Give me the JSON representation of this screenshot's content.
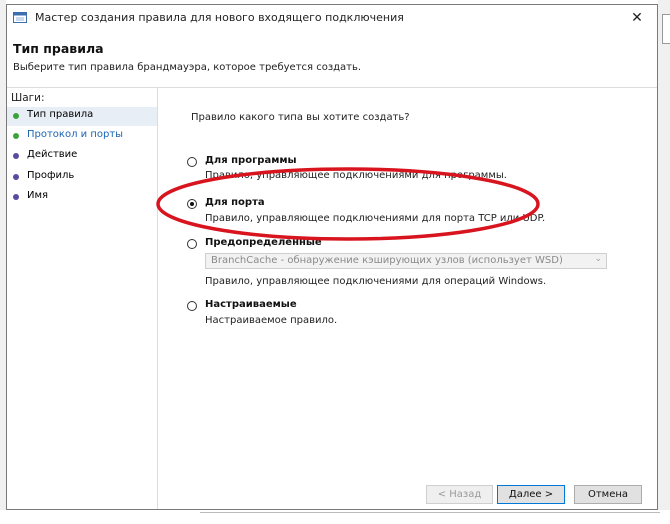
{
  "window": {
    "title": "Мастер создания правила для нового входящего подключения",
    "close_glyph": "✕"
  },
  "header": {
    "title": "Тип правила",
    "subtitle": "Выберите тип правила брандмауэра, которое требуется создать."
  },
  "steps": {
    "title": "Шаги:",
    "items": [
      {
        "label": "Тип правила",
        "status": "completed"
      },
      {
        "label": "Протокол и порты",
        "status": "current"
      },
      {
        "label": "Действие",
        "status": "pending"
      },
      {
        "label": "Профиль",
        "status": "pending"
      },
      {
        "label": "Имя",
        "status": "pending"
      }
    ]
  },
  "content": {
    "question": "Правило какого типа вы хотите создать?",
    "options": [
      {
        "title": "Для программы",
        "desc": "Правило, управляющее подключениями для программы.",
        "selected": false
      },
      {
        "title": "Для порта",
        "desc": "Правило, управляющее подключениями для порта TCP или UDP.",
        "selected": true
      },
      {
        "title": "Предопределенные",
        "desc": "Правило, управляющее подключениями для операций Windows.",
        "selected": false
      },
      {
        "title": "Настраиваемые",
        "desc": "Настраиваемое правило.",
        "selected": false
      }
    ],
    "predefined_dropdown": {
      "value": "BranchCache - обнаружение кэширующих узлов (использует WSD)",
      "arrow_glyph": "⌄",
      "enabled": false
    }
  },
  "buttons": {
    "back": "< Назад",
    "next": "Далее >",
    "cancel": "Отмена"
  },
  "colors": {
    "completed_step": "#3aa43a",
    "current_step": "#1a64b4",
    "pending_step": "#5a4aa0",
    "annotation": "#d8141e",
    "default_button_border": "#0078d7"
  },
  "icons": {
    "app": "firewall-window-icon",
    "close": "close-icon"
  }
}
